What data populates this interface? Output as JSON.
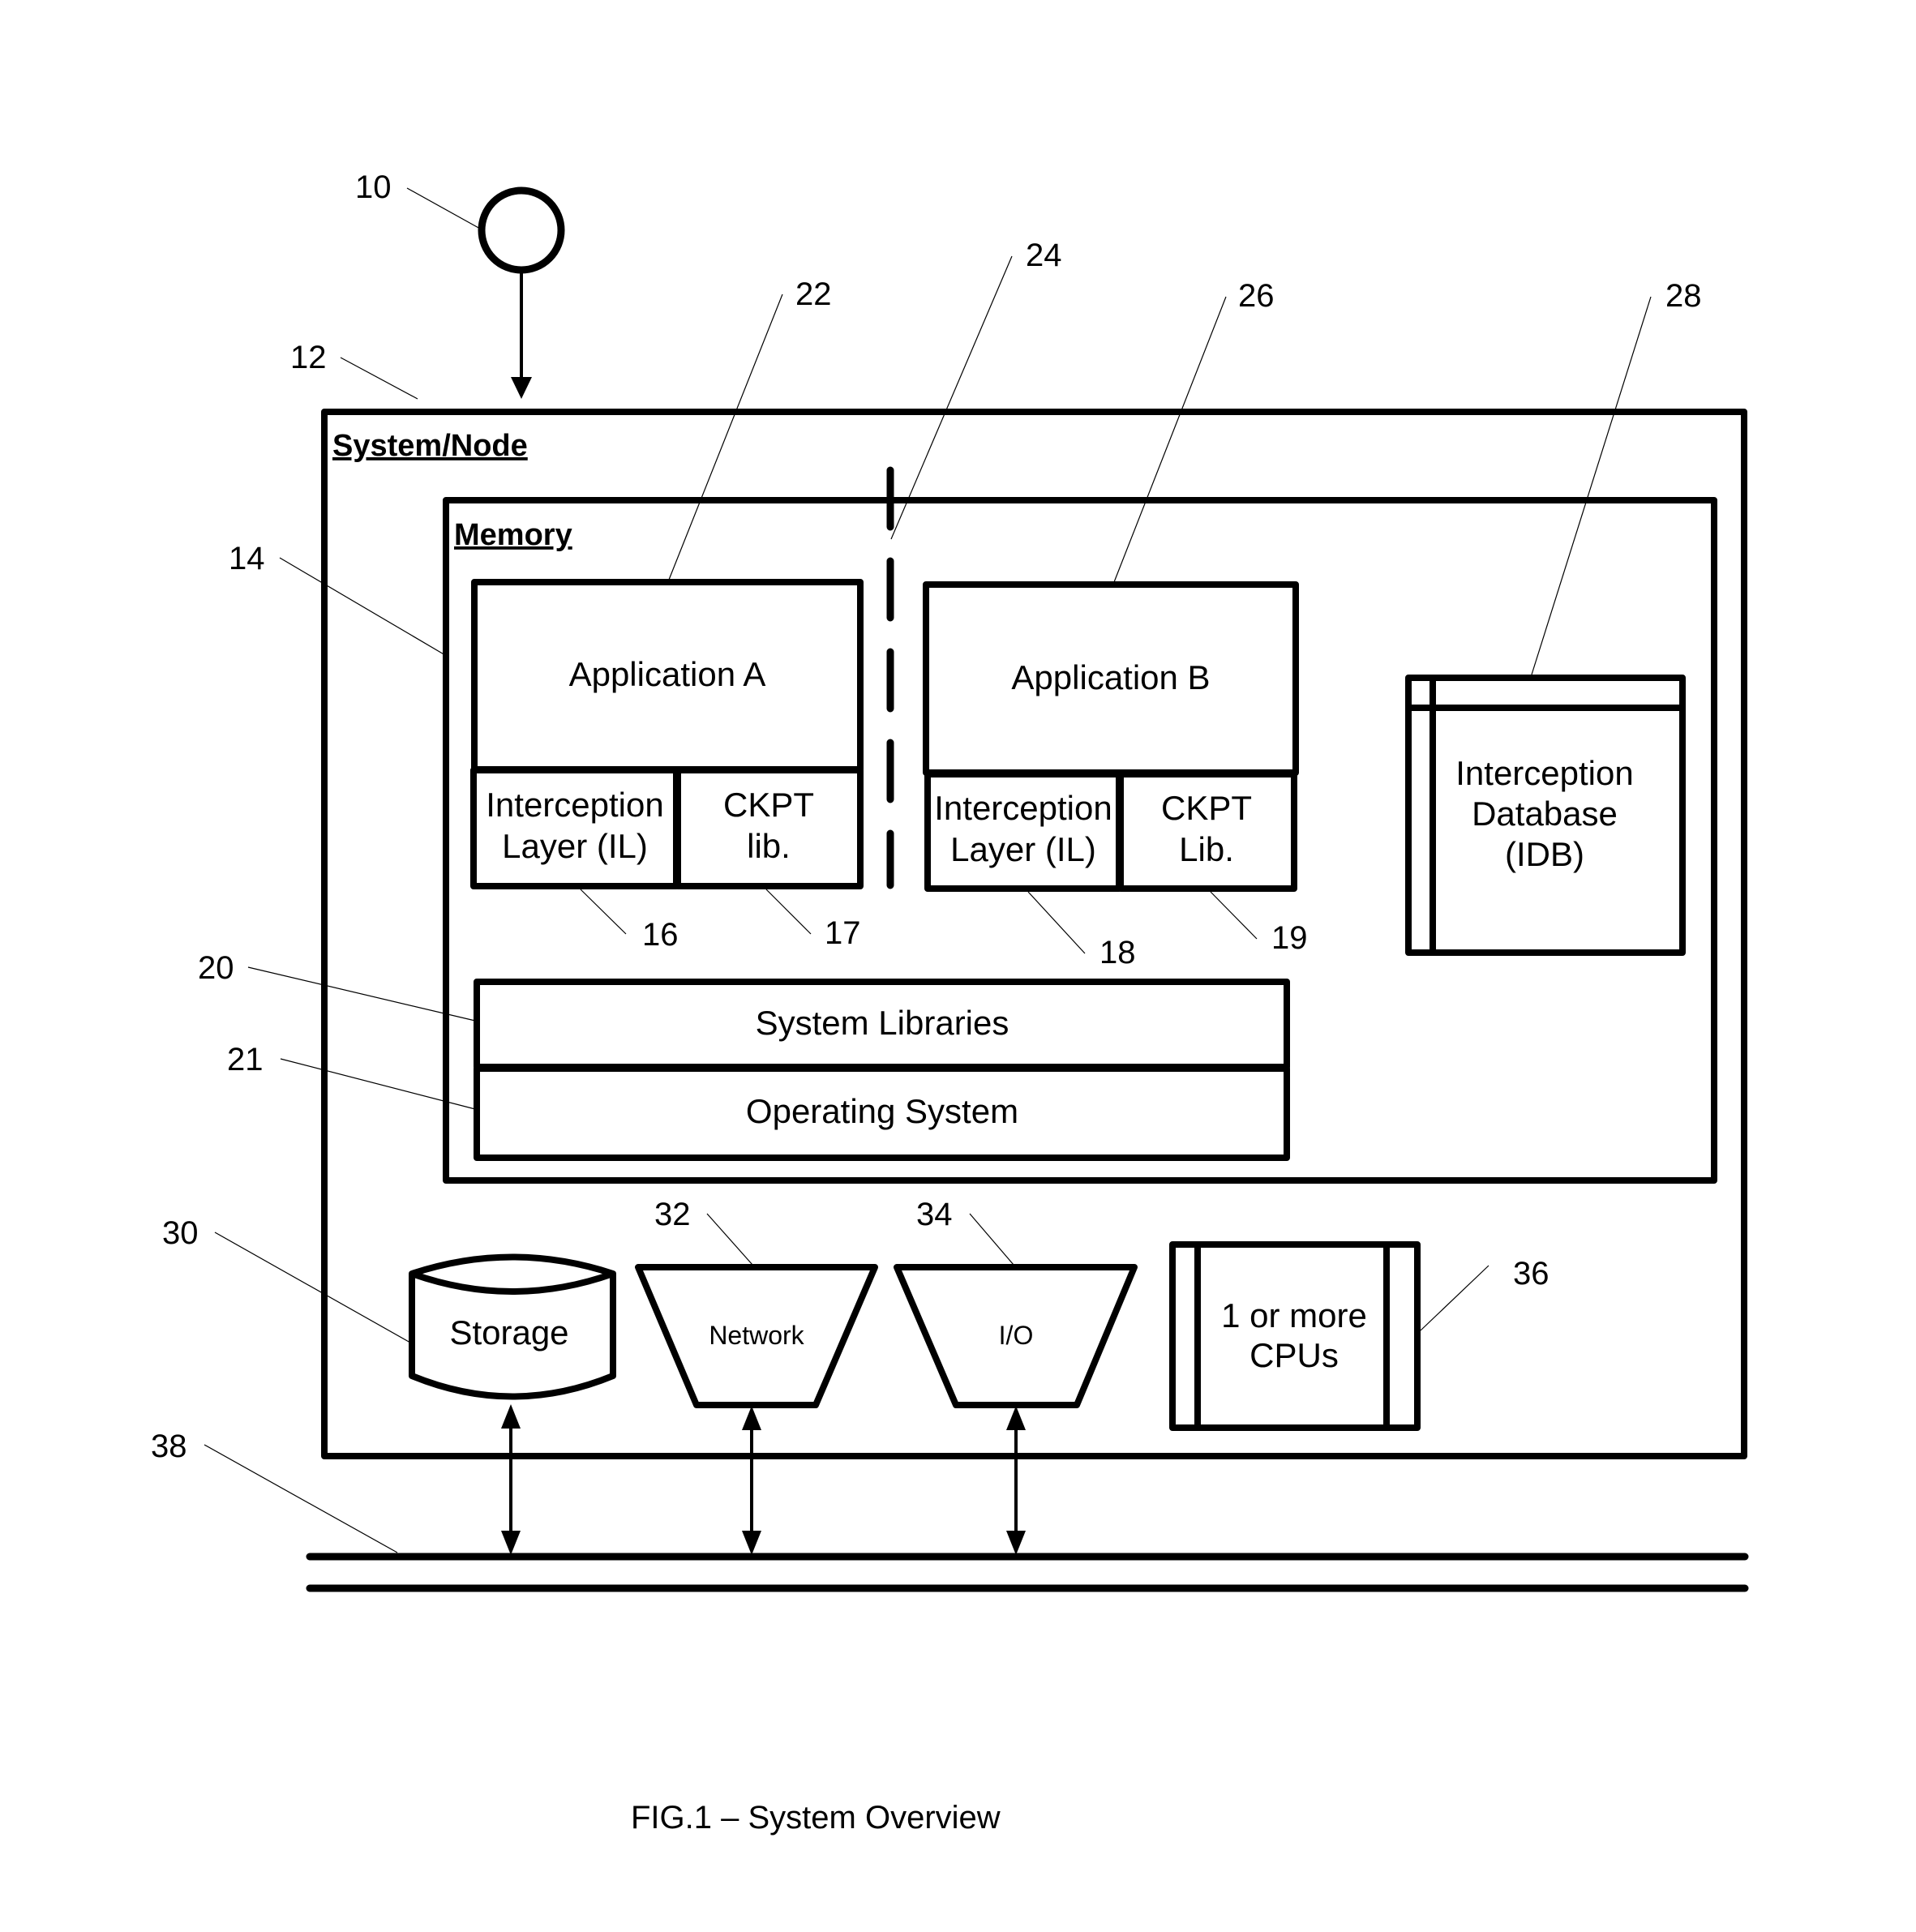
{
  "figure": {
    "caption": "FIG.1  – System Overview"
  },
  "system": {
    "title": "System/Node",
    "ref": "12"
  },
  "client": {
    "ref": "10",
    "icon": "circle-node-icon"
  },
  "memory": {
    "title": "Memory",
    "ref": "14",
    "separator_ref": "24",
    "app_a": {
      "label": "Application A",
      "ref": "22",
      "interception_layer": {
        "line1": "Interception",
        "line2": "Layer (IL)",
        "ref": "16"
      },
      "ckpt_lib": {
        "line1": "CKPT",
        "line2": "lib.",
        "ref": "17"
      }
    },
    "app_b": {
      "label": "Application B",
      "ref": "26",
      "interception_layer": {
        "line1": "Interception",
        "line2": "Layer (IL)",
        "ref": "18"
      },
      "ckpt_lib": {
        "line1": "CKPT",
        "line2": "Lib.",
        "ref": "19"
      }
    },
    "idb": {
      "line1": "Interception",
      "line2": "Database",
      "line3": "(IDB)",
      "ref": "28"
    },
    "system_libraries": {
      "label": "System Libraries",
      "ref": "20"
    },
    "operating_system": {
      "label": "Operating System",
      "ref": "21"
    }
  },
  "hardware": {
    "storage": {
      "label": "Storage",
      "ref": "30"
    },
    "network": {
      "label": "Network",
      "ref": "32"
    },
    "io": {
      "label": "I/O",
      "ref": "34"
    },
    "cpus": {
      "line1": "1 or more",
      "line2": "CPUs",
      "ref": "36"
    },
    "bus": {
      "ref": "38"
    }
  }
}
